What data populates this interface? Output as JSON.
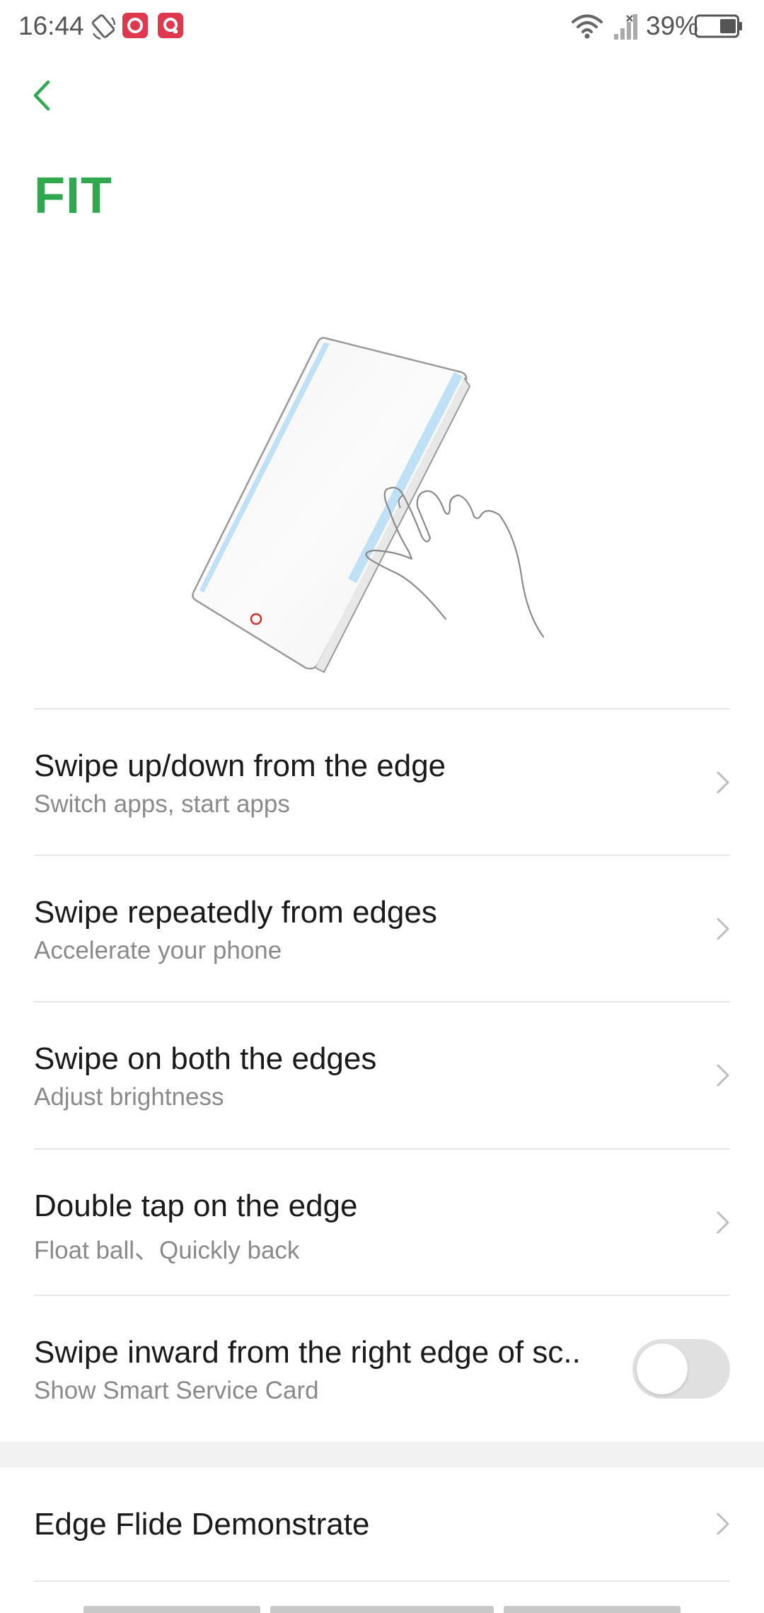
{
  "status_bar": {
    "time": "16:44",
    "battery": "39%",
    "icons": [
      "rotation-lock-icon",
      "app-notification-icon",
      "app-notification-icon",
      "wifi-icon",
      "cellular-signal-icon",
      "battery-icon"
    ]
  },
  "header": {
    "back_icon": "chevron-left-icon",
    "title": "FIT"
  },
  "illustration": {
    "icon": "phone-edge-swipe-illustration"
  },
  "settings": [
    {
      "title": "Swipe up/down from the edge",
      "subtitle": "Switch apps, start apps",
      "control": "chevron"
    },
    {
      "title": "Swipe repeatedly from edges",
      "subtitle": "Accelerate your phone",
      "control": "chevron"
    },
    {
      "title": "Swipe on both the edges",
      "subtitle": "Adjust brightness",
      "control": "chevron"
    },
    {
      "title": "Double tap on the edge",
      "subtitle": "Float ball、Quickly back",
      "control": "chevron"
    },
    {
      "title": "Swipe inward from the right edge of sc..",
      "subtitle": "Show Smart Service Card",
      "control": "toggle",
      "enabled": false
    }
  ],
  "demo": {
    "title": "Edge Flide Demonstrate"
  },
  "colors": {
    "accent": "#2fa84f",
    "title_text": "#1a1a1a",
    "subtitle_text": "#8a8a8a",
    "divider": "#e6e6e6",
    "toggle_off": "#e0e0e0",
    "phone_edge": "#bfe0f5"
  }
}
